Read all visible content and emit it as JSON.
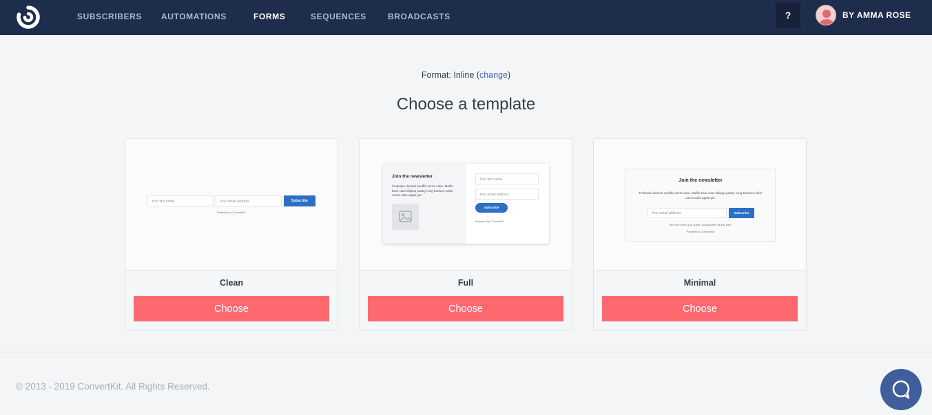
{
  "nav": {
    "items": [
      {
        "label": "SUBSCRIBERS",
        "active": false
      },
      {
        "label": "AUTOMATIONS",
        "active": false
      },
      {
        "label": "FORMS",
        "active": true
      },
      {
        "label": "SEQUENCES",
        "active": false
      },
      {
        "label": "BROADCASTS",
        "active": false
      }
    ],
    "help_label": "?",
    "account_name": "BY AMMA ROSE"
  },
  "format": {
    "prefix": "Format: Inline (",
    "change_label": "change",
    "suffix": ")"
  },
  "page_title": "Choose a template",
  "templates": [
    {
      "name": "Clean",
      "button_label": "Choose",
      "preview": {
        "first_name_placeholder": "Your first name",
        "email_placeholder": "Your email address",
        "subscribe_label": "Subscribe",
        "powered_by": "Powered by ConvertKit"
      }
    },
    {
      "name": "Full",
      "button_label": "Choose",
      "preview": {
        "heading": "Join the newsletter",
        "body": "Fruitcake dessert soufflé carrot cake. Muffin bear claw lollipop pastry icing bonbon wafer carrot cake apple pie.",
        "first_name_placeholder": "Your first name",
        "email_placeholder": "Your email address",
        "subscribe_label": "Subscribe",
        "powered_by": "Powered by ConvertKit",
        "image_icon": "image-placeholder-icon"
      }
    },
    {
      "name": "Minimal",
      "button_label": "Choose",
      "preview": {
        "heading": "Join the newsletter",
        "body": "Fruitcake dessert soufflé carrot cake. Muffin bear claw lollipop pastry icing bonbon wafer carrot cake apple pie.",
        "email_placeholder": "Your email address",
        "subscribe_label": "Subscribe",
        "no_spam": "We won't send you spam. Unsubscribe at any time.",
        "powered_by": "Powered by ConvertKit"
      }
    }
  ],
  "footer": {
    "copyright": "© 2013 - 2019 ConvertKit. All Rights Reserved."
  },
  "colors": {
    "nav_bg": "#1f2d4c",
    "page_bg": "#f3f5f7",
    "choose_button": "#fe696f",
    "link": "#3c6fb0",
    "chat_button": "#3f5e9b",
    "mini_subscribe": "#2d6fc2"
  },
  "icons": {
    "logo": "convertkit-logo-icon",
    "chat": "chat-bubble-icon",
    "avatar": "user-avatar-icon"
  }
}
